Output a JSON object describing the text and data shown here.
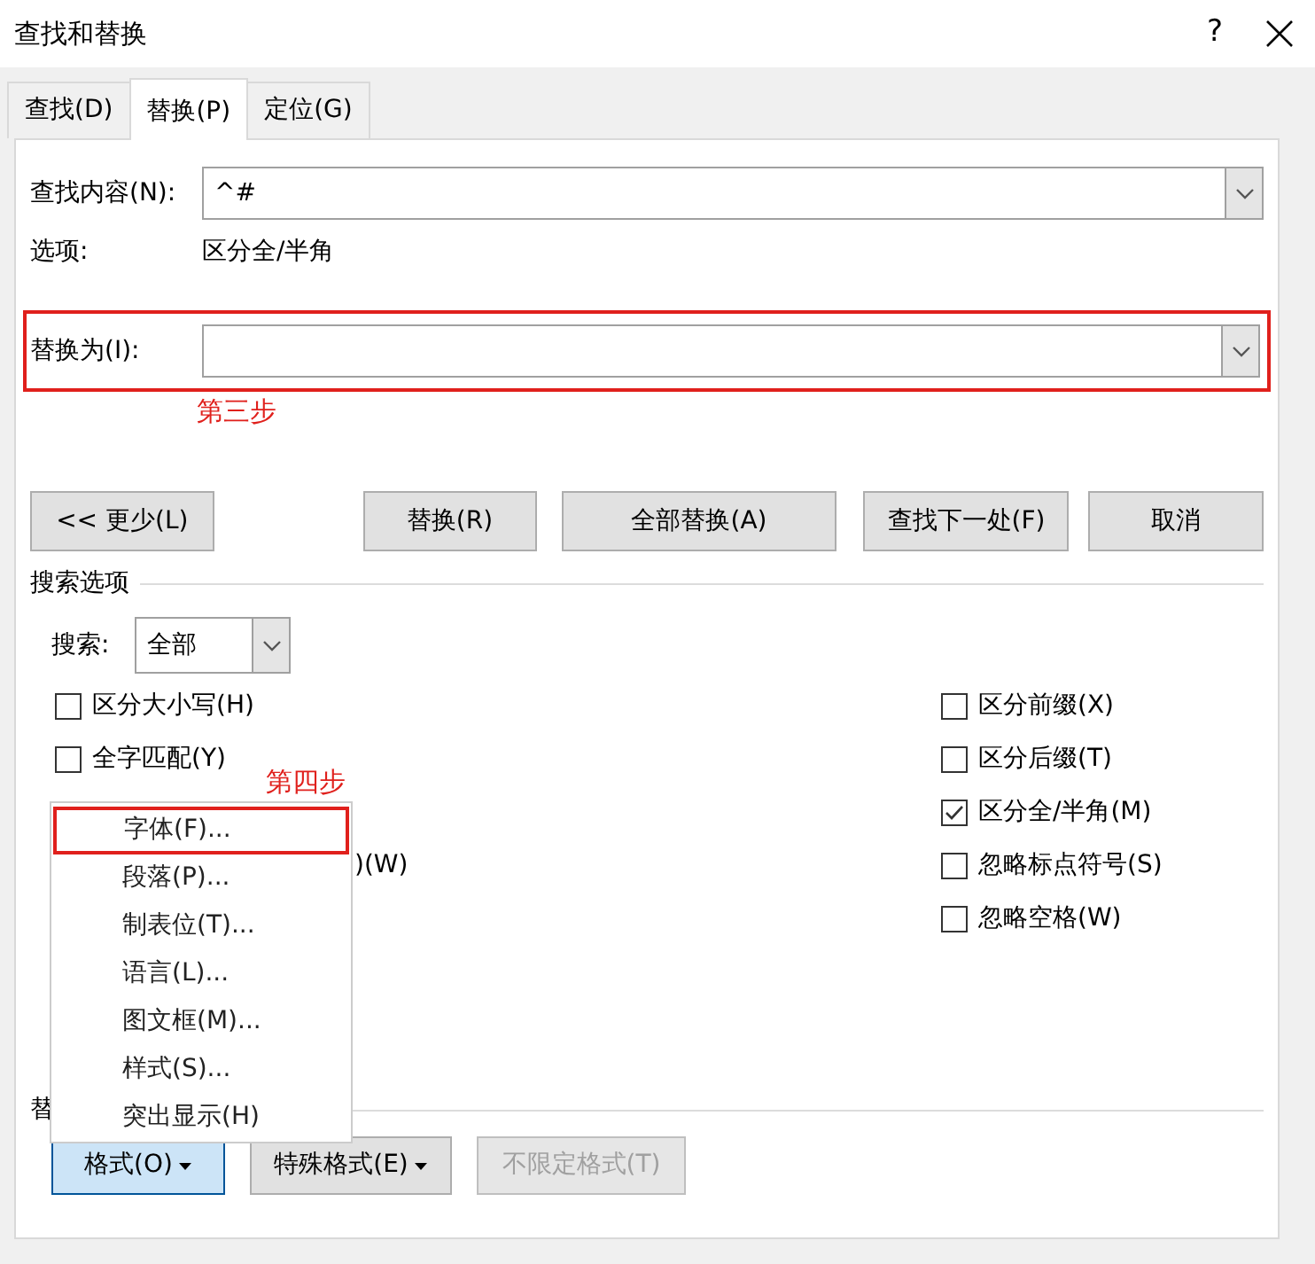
{
  "window": {
    "title": "查找和替换",
    "help": "?"
  },
  "tabs": [
    {
      "label": "查找(D)",
      "selected": false
    },
    {
      "label": "替换(P)",
      "selected": true
    },
    {
      "label": "定位(G)",
      "selected": false
    }
  ],
  "find": {
    "label": "查找内容(N):",
    "value": "^#"
  },
  "options": {
    "label": "选项:",
    "value": "区分全/半角"
  },
  "replace": {
    "label": "替换为(I):"
  },
  "annotations": [
    {
      "text": "第三步"
    },
    {
      "text": "第四步"
    }
  ],
  "less_button": "<< 更少(L)",
  "action_buttons": [
    "替换(R)",
    "全部替换(A)",
    "查找下一处(F)",
    "取消"
  ],
  "search_options": {
    "title": "搜索选项",
    "search_label": "搜索:",
    "search_value": "全部"
  },
  "left_checkboxes": [
    {
      "kind": "full",
      "label": "区分大小写(H)",
      "checked": false
    },
    {
      "kind": "full",
      "label": "全字匹配(Y)",
      "checked": false
    },
    {
      "kind": "fragment",
      "label": ")(W)"
    }
  ],
  "right_checkboxes": [
    {
      "label": "区分前缀(X)",
      "checked": false
    },
    {
      "label": "区分后缀(T)",
      "checked": false
    },
    {
      "label": "区分全/半角(M)",
      "checked": true
    },
    {
      "label": "忽略标点符号(S)",
      "checked": false
    },
    {
      "label": "忽略空格(W)",
      "checked": false
    }
  ],
  "replace_section": {
    "title": "替"
  },
  "bottom_buttons": [
    {
      "label": "格式(O)",
      "dropdown": true,
      "pressed": true,
      "disabled": false
    },
    {
      "label": "特殊格式(E)",
      "dropdown": true,
      "pressed": false,
      "disabled": false
    },
    {
      "label": "不限定格式(T)",
      "dropdown": false,
      "pressed": false,
      "disabled": true
    }
  ],
  "format_menu": [
    {
      "label": "字体(F)...",
      "marked": true
    },
    {
      "label": "段落(P)...",
      "marked": false
    },
    {
      "label": "制表位(T)...",
      "marked": false
    },
    {
      "label": "语言(L)...",
      "marked": false
    },
    {
      "label": "图文框(M)...",
      "marked": false
    },
    {
      "label": "样式(S)...",
      "marked": false
    },
    {
      "label": "突出显示(H)",
      "marked": false
    }
  ]
}
